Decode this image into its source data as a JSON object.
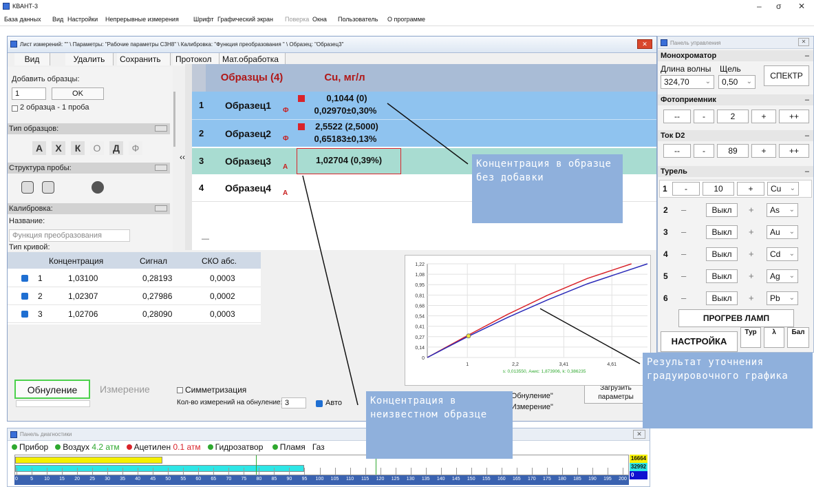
{
  "app": {
    "title": "КВАНТ-3",
    "window_controls": [
      "–",
      "σ",
      "✕"
    ]
  },
  "menu": [
    "База данных",
    "Вид",
    "Настройки",
    "Непрерывные измерения",
    "Шрифт",
    "Графический экран",
    "Поверка",
    "Окна",
    "Пользователь",
    "О программе"
  ],
  "sheet": {
    "title": "Лист измерений: \"\" \\ Параметры: \"Рабочие параметры С3Н8\" \\ Калибровка: \"Функция преобразования \" \\ Образец: \"Образец3\"",
    "toolbar": [
      "Вид",
      "Удалить",
      "Сохранить",
      "Протокол",
      "Мат.обработка"
    ],
    "ok_label": "OK",
    "add_samples_label": "Добавить образцы:",
    "add_count": "1",
    "two_samples_label": "2 образца - 1 проба",
    "sample_type_label": "Тип образцов:",
    "sample_types": [
      "А",
      "Х",
      "К",
      "О",
      "Д",
      "Ф"
    ],
    "probe_structure_label": "Структура пробы:",
    "calibration_label": "Калибровка:",
    "name_label": "Название:",
    "name_value": "Функция преобразования",
    "curve_type_label": "Тип кривой:",
    "collapse_glyph": "‹‹"
  },
  "samples": {
    "header_samples": "Образцы (4)",
    "header_element": "Cu, мг/л",
    "rows": [
      {
        "num": "1",
        "name": "Образец1",
        "flag": "Ф",
        "line1": "0,1044 (0)",
        "line2": "0,02970±0,30%",
        "marker": true
      },
      {
        "num": "2",
        "name": "Образец2",
        "flag": "Ф",
        "line1": "2,5522 (2,5000)",
        "line2": "0,65183±0,13%",
        "marker": true
      },
      {
        "num": "3",
        "name": "Образец3",
        "flag": "А",
        "line1": "1,02704 (0,39%)",
        "line2": "",
        "marker": false
      },
      {
        "num": "4",
        "name": "Образец4",
        "flag": "А",
        "line1": "",
        "line2": "",
        "marker": false
      }
    ],
    "footer_dash": "—"
  },
  "calibration_table": {
    "headers": [
      "Концентрация",
      "Сигнал",
      "СКО абс."
    ],
    "rows": [
      {
        "num": "1",
        "conc": "1,03100",
        "signal": "0,28193",
        "sko": "0,0003"
      },
      {
        "num": "2",
        "conc": "1,02307",
        "signal": "0,27986",
        "sko": "0,0002"
      },
      {
        "num": "3",
        "conc": "1,02706",
        "signal": "0,28090",
        "sko": "0,0003"
      }
    ]
  },
  "chart_data": {
    "type": "line",
    "y_ticks": [
      "1,22",
      "1,08",
      "0,95",
      "0,81",
      "0,68",
      "0,54",
      "0,41",
      "0,27",
      "0,14",
      "0"
    ],
    "x_ticks": [
      "1",
      "2,2",
      "3,41",
      "4,61"
    ],
    "ylim": [
      0,
      1.22
    ],
    "xlim": [
      0,
      5.5
    ],
    "footer": "s: 0,013550, Анис: 1,873906, k: 0,386235",
    "series": [
      {
        "color": "#d9232a",
        "x": [
          0,
          1,
          2,
          3,
          4,
          5.1
        ],
        "y": [
          0,
          0.285,
          0.56,
          0.81,
          1.03,
          1.22
        ]
      },
      {
        "color": "#2a2ab8",
        "x": [
          0,
          1,
          2,
          3,
          4,
          5.5
        ],
        "y": [
          0,
          0.27,
          0.52,
          0.75,
          0.96,
          1.22
        ]
      }
    ],
    "point": {
      "x": 1.03,
      "y": 0.281,
      "color": "#f5e63a"
    }
  },
  "controls": {
    "zero_label": "Обнуление",
    "measure_label": "Измерение",
    "symmetrize_label": "Симметризация",
    "zero_count_label": "Кол-во измерений на обнуление:",
    "zero_count": "3",
    "auto_label": "Авто",
    "load_params": "Загрузить параметры",
    "legend_zero": "F1 \"Обнуление\"",
    "legend_measure": "F2 \"Измерение\""
  },
  "diagnostics": {
    "title": "Панель диагностики",
    "items": [
      {
        "label": "Прибор",
        "value": "",
        "color": "#2fa82f"
      },
      {
        "label": "Воздух",
        "value": "4.2 атм",
        "color": "#2fa82f"
      },
      {
        "label": "Ацетилен",
        "value": "0.1 атм",
        "color": "#d9232a"
      },
      {
        "label": "Гидрозатвор",
        "value": "",
        "color": "#2fa82f"
      },
      {
        "label": "Пламя",
        "value": "",
        "color": "#2fa82f"
      },
      {
        "label": "Газ",
        "value": "",
        "color": "#2fa82f"
      }
    ],
    "scale": [
      "0",
      "5",
      "10",
      "15",
      "20",
      "25",
      "30",
      "35",
      "40",
      "45",
      "50",
      "55",
      "60",
      "65",
      "70",
      "75",
      "80",
      "85",
      "90",
      "95",
      "100",
      "105",
      "110",
      "115",
      "120",
      "125",
      "130",
      "135",
      "140",
      "145",
      "150",
      "155",
      "160",
      "165",
      "170",
      "175",
      "180",
      "185",
      "190",
      "195",
      "200"
    ],
    "readouts": [
      "16664",
      "32992",
      "0"
    ],
    "bar_yellow_pct": 0.24,
    "bar_cyan_pct": 0.47
  },
  "control_panel": {
    "title": "Панель управления",
    "mono_label": "Монохроматор",
    "wavelength_label": "Длина волны",
    "slit_label": "Щель",
    "wavelength": "324,70",
    "slit": "0,50",
    "spectrum": "СПЕКТР",
    "photo_label": "Фотоприемник",
    "photo_value": "2",
    "current_label": "Ток D2",
    "current_value": "89",
    "btn_mm": "--",
    "btn_m": "-",
    "btn_p": "+",
    "btn_pp": "++",
    "turret_label": "Турель",
    "turret": [
      {
        "n": "1",
        "value": "10",
        "elem": "Cu",
        "active": true
      },
      {
        "n": "2",
        "value": "Выкл",
        "elem": "As",
        "active": false
      },
      {
        "n": "3",
        "value": "Выкл",
        "elem": "Au",
        "active": false
      },
      {
        "n": "4",
        "value": "Выкл",
        "elem": "Cd",
        "active": false
      },
      {
        "n": "5",
        "value": "Выкл",
        "elem": "Ag",
        "active": false
      },
      {
        "n": "6",
        "value": "Выкл",
        "elem": "Pb",
        "active": false
      }
    ],
    "warmup": "ПРОГРЕВ ЛАМП",
    "setup": "НАСТРОЙКА",
    "tabs": [
      "Тур",
      "λ",
      "Бал"
    ]
  },
  "annotations": {
    "note1": "Концентрация в образце без добавки",
    "note2": "Концентрация в неизвестном образце",
    "note3": "Результат уточнения градуировочного графика"
  }
}
